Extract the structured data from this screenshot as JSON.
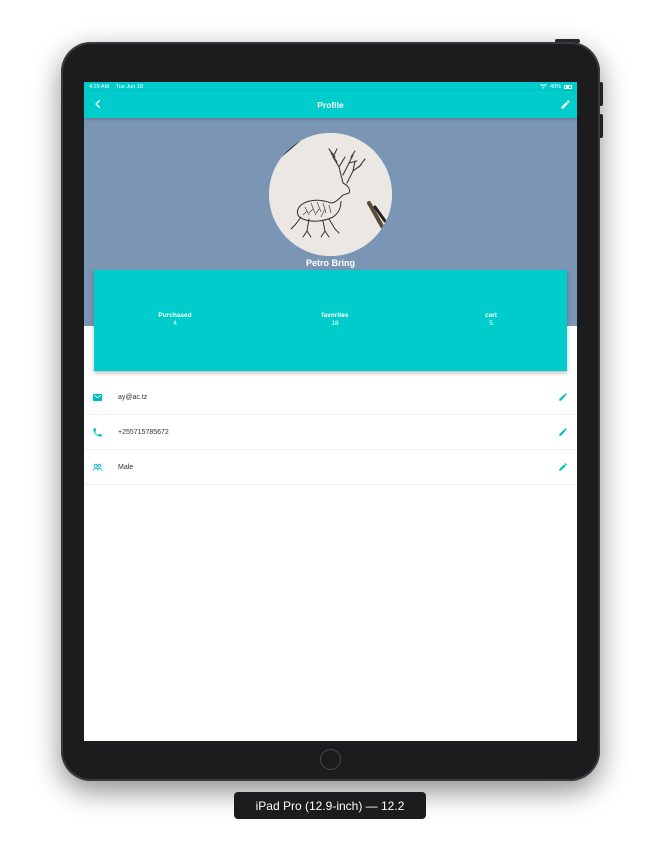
{
  "device": {
    "label": "iPad Pro (12.9-inch) — 12.2"
  },
  "status_bar": {
    "time": "4:29 AM",
    "date": "Tue Jun 18",
    "battery": "40%"
  },
  "app_bar": {
    "title": "Profile",
    "back_icon": "chevron-left-icon",
    "edit_icon": "pencil-icon"
  },
  "profile": {
    "name": "Petro Bring",
    "header_color": "#7b95b4"
  },
  "stats": [
    {
      "label": "Purchased",
      "value": "4"
    },
    {
      "label": "favorites",
      "value": "18"
    },
    {
      "label": "cart",
      "value": "5"
    }
  ],
  "info": [
    {
      "icon": "email-icon",
      "value": "ay@ac.tz"
    },
    {
      "icon": "phone-icon",
      "value": "+255715785672"
    },
    {
      "icon": "people-icon",
      "value": "Male"
    }
  ],
  "colors": {
    "accent": "#00cccc",
    "header": "#7b95b4",
    "device": "#1c1c1e"
  }
}
